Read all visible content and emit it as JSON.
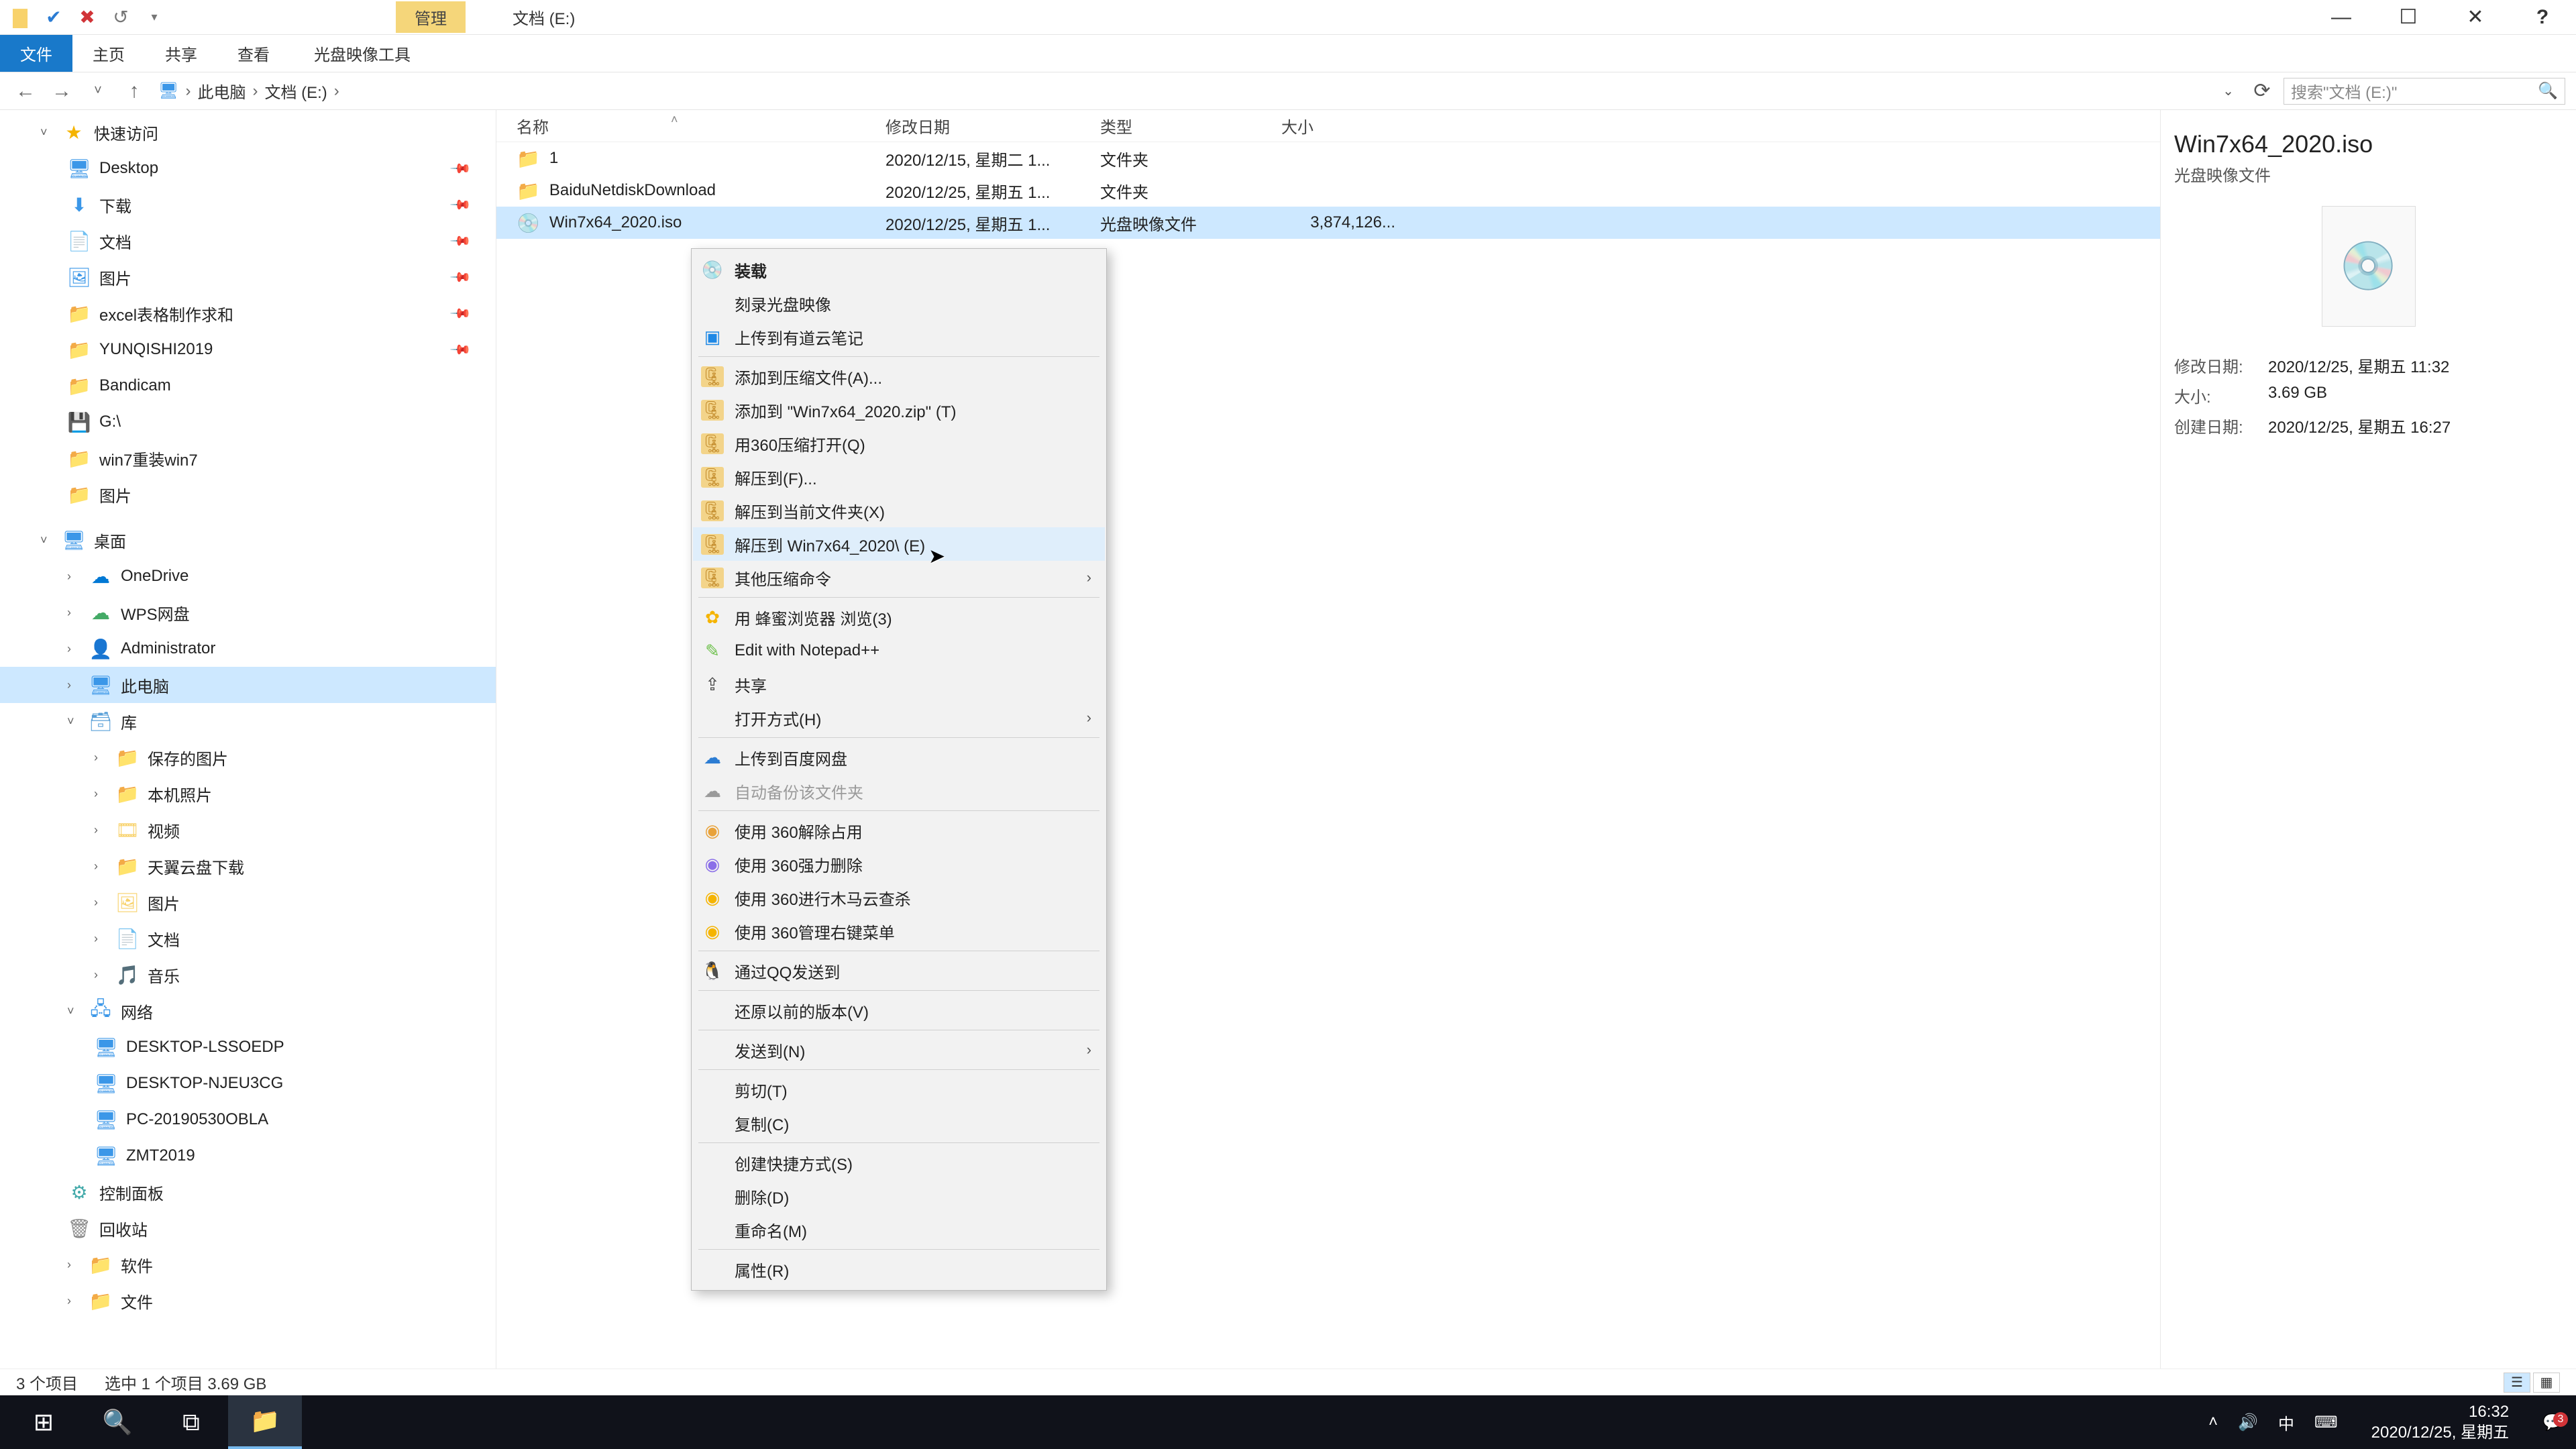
{
  "title_tab": "管理",
  "title_location": "文档 (E:)",
  "ribbon": {
    "file": "文件",
    "home": "主页",
    "share": "共享",
    "view": "查看",
    "iso_tools": "光盘映像工具"
  },
  "breadcrumb": {
    "root": "此电脑",
    "cur": "文档 (E:)"
  },
  "search_placeholder": "搜索\"文档 (E:)\"",
  "columns": {
    "name": "名称",
    "date": "修改日期",
    "type": "类型",
    "size": "大小"
  },
  "rows": [
    {
      "icon": "folder",
      "name": "1",
      "date": "2020/12/15, 星期二 1...",
      "type": "文件夹",
      "size": ""
    },
    {
      "icon": "folder",
      "name": "BaiduNetdiskDownload",
      "date": "2020/12/25, 星期五 1...",
      "type": "文件夹",
      "size": ""
    },
    {
      "icon": "iso",
      "name": "Win7x64_2020.iso",
      "date": "2020/12/25, 星期五 1...",
      "type": "光盘映像文件",
      "size": "3,874,126..."
    }
  ],
  "tree": {
    "quick": "快速访问",
    "quick_items": [
      "Desktop",
      "下载",
      "文档",
      "图片",
      "excel表格制作求和",
      "YUNQISHI2019",
      "Bandicam",
      "G:\\",
      "win7重装win7",
      "图片"
    ],
    "desktop": "桌面",
    "desktop_items": [
      "OneDrive",
      "WPS网盘",
      "Administrator",
      "此电脑",
      "库"
    ],
    "lib_items": [
      "保存的图片",
      "本机照片",
      "视频",
      "天翼云盘下载",
      "图片",
      "文档",
      "音乐"
    ],
    "network": "网络",
    "net_items": [
      "DESKTOP-LSSOEDP",
      "DESKTOP-NJEU3CG",
      "PC-20190530OBLA",
      "ZMT2019"
    ],
    "bottom": [
      "控制面板",
      "回收站",
      "软件",
      "文件"
    ]
  },
  "details": {
    "name": "Win7x64_2020.iso",
    "subtitle": "光盘映像文件",
    "mod_k": "修改日期:",
    "mod_v": "2020/12/25, 星期五 11:32",
    "size_k": "大小:",
    "size_v": "3.69 GB",
    "cre_k": "创建日期:",
    "cre_v": "2020/12/25, 星期五 16:27"
  },
  "status": {
    "count": "3 个项目",
    "sel": "选中 1 个项目  3.69 GB"
  },
  "ctx": {
    "mount": "装载",
    "burn": "刻录光盘映像",
    "youdao": "上传到有道云笔记",
    "add_archive": "添加到压缩文件(A)...",
    "add_zip": "添加到 \"Win7x64_2020.zip\" (T)",
    "open_360zip": "用360压缩打开(Q)",
    "extract_to": "解压到(F)...",
    "extract_here": "解压到当前文件夹(X)",
    "extract_named": "解压到 Win7x64_2020\\ (E)",
    "other_zip": "其他压缩命令",
    "bee": "用 蜂蜜浏览器 浏览(3)",
    "npp": "Edit with Notepad++",
    "share": "共享",
    "open_with": "打开方式(H)",
    "baidupan": "上传到百度网盘",
    "auto_backup": "自动备份该文件夹",
    "s360_unlock": "使用 360解除占用",
    "s360_force": "使用 360强力删除",
    "s360_scan": "使用 360进行木马云查杀",
    "s360_menu": "使用 360管理右键菜单",
    "qq_send": "通过QQ发送到",
    "restore": "还原以前的版本(V)",
    "send_to": "发送到(N)",
    "cut": "剪切(T)",
    "copy": "复制(C)",
    "shortcut": "创建快捷方式(S)",
    "delete": "删除(D)",
    "rename": "重命名(M)",
    "props": "属性(R)"
  },
  "taskbar": {
    "ime": "中",
    "time": "16:32",
    "date": "2020/12/25, 星期五"
  }
}
